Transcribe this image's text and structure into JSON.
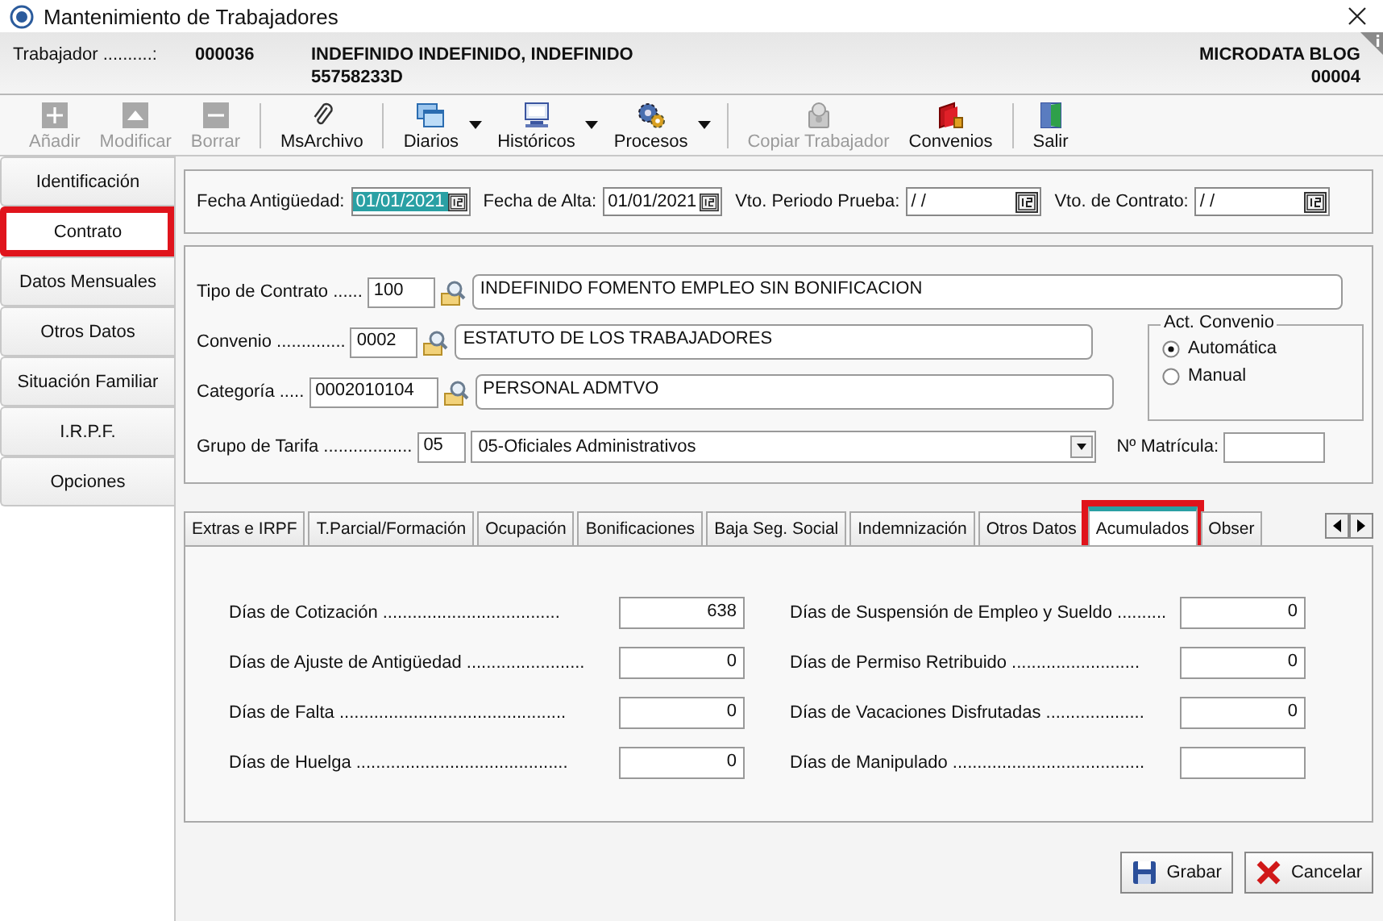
{
  "window": {
    "title": "Mantenimiento de Trabajadores"
  },
  "header": {
    "label": "Trabajador ..........:",
    "code": "000036",
    "name": "INDEFINIDO INDEFINIDO, INDEFINIDO",
    "id": "55758233D",
    "company": "MICRODATA BLOG",
    "company_code": "00004"
  },
  "toolbar": [
    [
      {
        "label": "Añadir",
        "disabled": true,
        "dropdown": false
      },
      {
        "label": "Modificar",
        "disabled": true,
        "dropdown": false
      },
      {
        "label": "Borrar",
        "disabled": true,
        "dropdown": false
      }
    ],
    [
      {
        "label": "MsArchivo",
        "disabled": false,
        "dropdown": false
      }
    ],
    [
      {
        "label": "Diarios",
        "disabled": false,
        "dropdown": true
      },
      {
        "label": "Históricos",
        "disabled": false,
        "dropdown": true
      },
      {
        "label": "Procesos",
        "disabled": false,
        "dropdown": true
      }
    ],
    [
      {
        "label": "Copiar Trabajador",
        "disabled": true,
        "dropdown": false
      },
      {
        "label": "Convenios",
        "disabled": false,
        "dropdown": false
      }
    ],
    [
      {
        "label": "Salir",
        "disabled": false,
        "dropdown": false
      }
    ]
  ],
  "sidebar": {
    "items": [
      {
        "label": "Identificación",
        "selected": false,
        "highlighted": false
      },
      {
        "label": "Contrato",
        "selected": true,
        "highlighted": true
      },
      {
        "label": "Datos Mensuales",
        "selected": false,
        "highlighted": false
      },
      {
        "label": "Otros Datos",
        "selected": false,
        "highlighted": false
      },
      {
        "label": "Situación Familiar",
        "selected": false,
        "highlighted": false
      },
      {
        "label": "I.R.P.F.",
        "selected": false,
        "highlighted": false
      },
      {
        "label": "Opciones",
        "selected": false,
        "highlighted": false
      }
    ]
  },
  "dates": [
    {
      "label": "Fecha Antigüedad:",
      "value": "01/01/2021",
      "focused": true
    },
    {
      "label": "Fecha de Alta:",
      "value": "01/01/2021",
      "focused": false
    },
    {
      "label": "Vto. Periodo Prueba:",
      "value": "/ /",
      "focused": false
    },
    {
      "label": "Vto. de Contrato:",
      "value": "/ /",
      "focused": false
    }
  ],
  "contract": {
    "lookups": [
      {
        "label": "Tipo de Contrato ......",
        "code": "100",
        "description": "INDEFINIDO FOMENTO EMPLEO SIN BONIFICACION",
        "kind": "wide"
      },
      {
        "label": "Convenio ..............",
        "code": "0002",
        "description": "ESTATUTO DE LOS TRABAJADORES",
        "kind": "short"
      },
      {
        "label": "Categoría .....",
        "code": "0002010104",
        "description": "PERSONAL ADMTVO",
        "kind": "short"
      }
    ],
    "act_convenio": {
      "title": "Act. Convenio",
      "options": [
        {
          "label": "Automática",
          "selected": true
        },
        {
          "label": "Manual",
          "selected": false
        }
      ]
    },
    "grupo": {
      "label": "Grupo de Tarifa ..................",
      "code": "05",
      "value": "05-Oficiales Administrativos"
    },
    "matricula": {
      "label": "Nº Matrícula:"
    }
  },
  "tabs": [
    {
      "label": "Extras e IRPF",
      "selected": false,
      "highlighted": false
    },
    {
      "label": "T.Parcial/Formación",
      "selected": false,
      "highlighted": false
    },
    {
      "label": "Ocupación",
      "selected": false,
      "highlighted": false
    },
    {
      "label": "Bonificaciones",
      "selected": false,
      "highlighted": false
    },
    {
      "label": "Baja Seg. Social",
      "selected": false,
      "highlighted": false
    },
    {
      "label": "Indemnización",
      "selected": false,
      "highlighted": false
    },
    {
      "label": "Otros Datos",
      "selected": false,
      "highlighted": false
    },
    {
      "label": "Acumulados",
      "selected": true,
      "highlighted": true
    },
    {
      "label": "Obser",
      "selected": false,
      "highlighted": false
    }
  ],
  "accumulated": {
    "left": [
      {
        "label": "Días de Cotización ....................................",
        "value": "638"
      },
      {
        "label": "Días de Ajuste de Antigüedad ........................",
        "value": "0"
      },
      {
        "label": "Días de Falta ..............................................",
        "value": "0"
      },
      {
        "label": "Días de Huelga ...........................................",
        "value": "0"
      }
    ],
    "right": [
      {
        "label": "Días de Suspensión de Empleo y Sueldo ..........",
        "value": "0"
      },
      {
        "label": "Días de Permiso Retribuido ..........................",
        "value": "0"
      },
      {
        "label": "Días de Vacaciones Disfrutadas ....................",
        "value": "0"
      },
      {
        "label": "Días de Manipulado ......................................."
      }
    ]
  },
  "buttons": [
    {
      "label": "Grabar",
      "kind": "save"
    },
    {
      "label": "Cancelar",
      "kind": "cancel"
    }
  ]
}
